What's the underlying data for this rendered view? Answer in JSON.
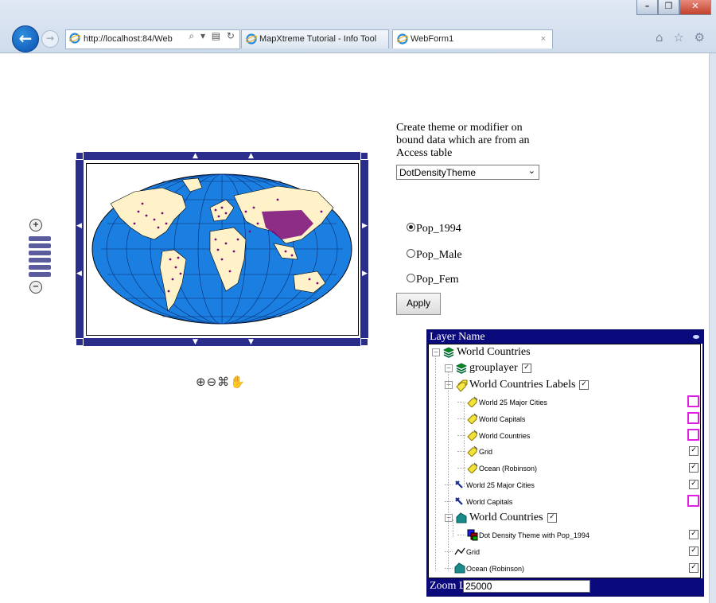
{
  "browser": {
    "window_buttons": [
      "–",
      "❐",
      "✕"
    ],
    "address": "http://localhost:84/Web",
    "address_controls": "⌕ ▾ ▤ ↻",
    "tabs": [
      {
        "label": "MapXtreme Tutorial - Info Tool",
        "active": false
      },
      {
        "label": "WebForm1",
        "active": true
      }
    ],
    "tab_close": "×",
    "nav_icons": "⌂ ☆ ⚙"
  },
  "theme": {
    "description": "Create theme or modifier on bound data which are from an Access table",
    "selected": "DotDensityTheme",
    "options": [
      {
        "label": "Pop_1994",
        "checked": true
      },
      {
        "label": "Pop_Male",
        "checked": false
      },
      {
        "label": "Pop_Fem",
        "checked": false
      }
    ],
    "apply_label": "Apply"
  },
  "map_tools": "⊕⊖⌘✋",
  "zoom_slider": {
    "in": "+",
    "out": "−"
  },
  "layer_control": {
    "header": "Layer Name",
    "rows": [
      {
        "label": "World Countries",
        "icon": "layer-group-icon",
        "level": 0,
        "size": "big",
        "toggle": "−",
        "checkbox": null
      },
      {
        "label": "grouplayer",
        "icon": "layer-group-icon",
        "level": 1,
        "size": "big",
        "toggle": "−",
        "checkbox": "inline-checked"
      },
      {
        "label": "World Countries Labels",
        "icon": "label-layer-icon",
        "level": 1,
        "size": "big",
        "toggle": "−",
        "checkbox": "inline-checked"
      },
      {
        "label": "World 25 Major Cities",
        "icon": "label-tag-icon",
        "level": 2,
        "size": "small",
        "toggle": null,
        "checkbox": "highlight"
      },
      {
        "label": "World Capitals",
        "icon": "label-tag-icon",
        "level": 2,
        "size": "small",
        "toggle": null,
        "checkbox": "highlight"
      },
      {
        "label": "World Countries",
        "icon": "label-tag-icon",
        "level": 2,
        "size": "small",
        "toggle": null,
        "checkbox": "highlight"
      },
      {
        "label": "Grid",
        "icon": "label-tag-icon",
        "level": 2,
        "size": "small",
        "toggle": null,
        "checkbox": "checked"
      },
      {
        "label": "Ocean (Robinson)",
        "icon": "label-tag-icon",
        "level": 2,
        "size": "small",
        "toggle": null,
        "checkbox": "checked"
      },
      {
        "label": "World 25 Major Cities",
        "icon": "point-layer-icon",
        "level": 1,
        "size": "small",
        "toggle": null,
        "checkbox": "checked"
      },
      {
        "label": "World Capitals",
        "icon": "point-layer-icon",
        "level": 1,
        "size": "small",
        "toggle": null,
        "checkbox": "highlight"
      },
      {
        "label": "World Countries",
        "icon": "region-layer-icon",
        "level": 1,
        "size": "big",
        "toggle": "−",
        "checkbox": "inline-checked"
      },
      {
        "label": "Dot Density Theme with Pop_1994",
        "icon": "theme-icon",
        "level": 2,
        "size": "small",
        "toggle": null,
        "checkbox": "checked"
      },
      {
        "label": "Grid",
        "icon": "line-layer-icon",
        "level": 1,
        "size": "small",
        "toggle": null,
        "checkbox": "checked"
      },
      {
        "label": "Ocean (Robinson)",
        "icon": "region-layer-icon",
        "level": 1,
        "size": "small",
        "toggle": null,
        "checkbox": "checked"
      }
    ],
    "zoom_label": "Zoom Level",
    "zoom_value": "25000"
  },
  "colors": {
    "ocean": "#1a7fe0",
    "land": "#fff2c8",
    "dots": "#7a0a7a",
    "frame": "#2b2d8a",
    "panel_header": "#0a0a7c",
    "highlight": "#e020e0"
  }
}
